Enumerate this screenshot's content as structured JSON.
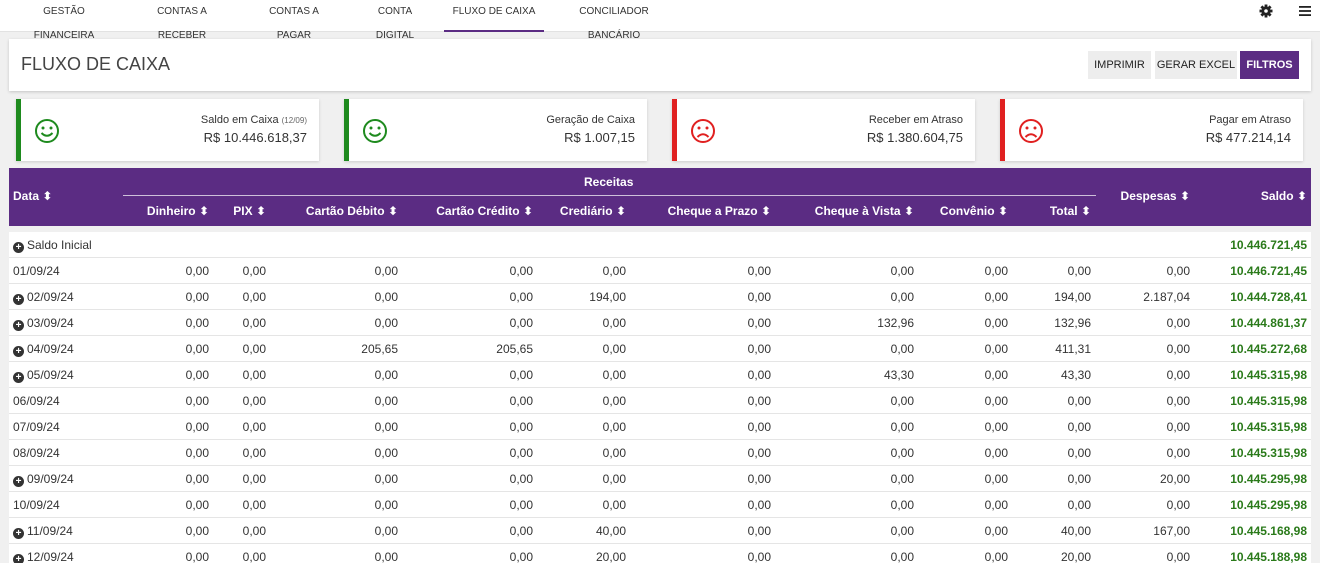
{
  "nav": {
    "tabs": [
      {
        "label": "GESTÃO FINANCEIRA"
      },
      {
        "label": "CONTAS A RECEBER"
      },
      {
        "label": "CONTAS A PAGAR"
      },
      {
        "label": "CONTA DIGITAL"
      },
      {
        "label": "FLUXO DE CAIXA"
      },
      {
        "label": "CONCILIADOR BANCÁRIO"
      }
    ],
    "active_tab": "FLUXO DE CAIXA"
  },
  "header": {
    "title": "FLUXO DE CAIXA",
    "buttons": {
      "print": "IMPRIMIR",
      "excel": "GERAR EXCEL",
      "filters": "FILTROS"
    }
  },
  "colors": {
    "accent": "#5b2c83",
    "positive": "#1e8a1e",
    "negative": "#e02020",
    "saldo": "#2a7a1a"
  },
  "cards": [
    {
      "label": "Saldo em Caixa",
      "note": "(12/09)",
      "value": "R$ 10.446.618,37",
      "status": "happy"
    },
    {
      "label": "Geração de Caixa",
      "value": "R$ 1.007,15",
      "status": "happy"
    },
    {
      "label": "Receber em Atraso",
      "value": "R$ 1.380.604,75",
      "status": "sad"
    },
    {
      "label": "Pagar em Atraso",
      "value": "R$ 477.214,14",
      "status": "sad"
    }
  ],
  "table": {
    "group_header": "Receitas",
    "columns": {
      "data": "Data",
      "dinheiro": "Dinheiro",
      "pix": "PIX",
      "cartao_debito": "Cartão Débito",
      "cartao_credito": "Cartão Crédito",
      "crediario": "Crediário",
      "cheque_prazo": "Cheque a Prazo",
      "cheque_vista": "Cheque à Vista",
      "convenio": "Convênio",
      "total": "Total",
      "despesas": "Despesas",
      "saldo": "Saldo"
    },
    "initial": {
      "label": "Saldo Inicial",
      "saldo": "10.446.721,45"
    },
    "rows": [
      {
        "date": "01/09/24",
        "expand": false,
        "v": [
          "0,00",
          "0,00",
          "0,00",
          "0,00",
          "0,00",
          "0,00",
          "0,00",
          "0,00",
          "0,00",
          "0,00"
        ],
        "saldo": "10.446.721,45"
      },
      {
        "date": "02/09/24",
        "expand": true,
        "v": [
          "0,00",
          "0,00",
          "0,00",
          "0,00",
          "194,00",
          "0,00",
          "0,00",
          "0,00",
          "194,00",
          "2.187,04"
        ],
        "saldo": "10.444.728,41"
      },
      {
        "date": "03/09/24",
        "expand": true,
        "v": [
          "0,00",
          "0,00",
          "0,00",
          "0,00",
          "0,00",
          "0,00",
          "132,96",
          "0,00",
          "132,96",
          "0,00"
        ],
        "saldo": "10.444.861,37"
      },
      {
        "date": "04/09/24",
        "expand": true,
        "v": [
          "0,00",
          "0,00",
          "205,65",
          "205,65",
          "0,00",
          "0,00",
          "0,00",
          "0,00",
          "411,31",
          "0,00"
        ],
        "saldo": "10.445.272,68"
      },
      {
        "date": "05/09/24",
        "expand": true,
        "v": [
          "0,00",
          "0,00",
          "0,00",
          "0,00",
          "0,00",
          "0,00",
          "43,30",
          "0,00",
          "43,30",
          "0,00"
        ],
        "saldo": "10.445.315,98"
      },
      {
        "date": "06/09/24",
        "expand": false,
        "v": [
          "0,00",
          "0,00",
          "0,00",
          "0,00",
          "0,00",
          "0,00",
          "0,00",
          "0,00",
          "0,00",
          "0,00"
        ],
        "saldo": "10.445.315,98"
      },
      {
        "date": "07/09/24",
        "expand": false,
        "v": [
          "0,00",
          "0,00",
          "0,00",
          "0,00",
          "0,00",
          "0,00",
          "0,00",
          "0,00",
          "0,00",
          "0,00"
        ],
        "saldo": "10.445.315,98"
      },
      {
        "date": "08/09/24",
        "expand": false,
        "v": [
          "0,00",
          "0,00",
          "0,00",
          "0,00",
          "0,00",
          "0,00",
          "0,00",
          "0,00",
          "0,00",
          "0,00"
        ],
        "saldo": "10.445.315,98"
      },
      {
        "date": "09/09/24",
        "expand": true,
        "v": [
          "0,00",
          "0,00",
          "0,00",
          "0,00",
          "0,00",
          "0,00",
          "0,00",
          "0,00",
          "0,00",
          "20,00"
        ],
        "saldo": "10.445.295,98"
      },
      {
        "date": "10/09/24",
        "expand": false,
        "v": [
          "0,00",
          "0,00",
          "0,00",
          "0,00",
          "0,00",
          "0,00",
          "0,00",
          "0,00",
          "0,00",
          "0,00"
        ],
        "saldo": "10.445.295,98"
      },
      {
        "date": "11/09/24",
        "expand": true,
        "v": [
          "0,00",
          "0,00",
          "0,00",
          "0,00",
          "40,00",
          "0,00",
          "0,00",
          "0,00",
          "40,00",
          "167,00"
        ],
        "saldo": "10.445.168,98"
      },
      {
        "date": "12/09/24",
        "expand": true,
        "v": [
          "0,00",
          "0,00",
          "0,00",
          "0,00",
          "20,00",
          "0,00",
          "0,00",
          "0,00",
          "20,00",
          "0,00"
        ],
        "saldo": "10.445.188,98"
      }
    ]
  }
}
